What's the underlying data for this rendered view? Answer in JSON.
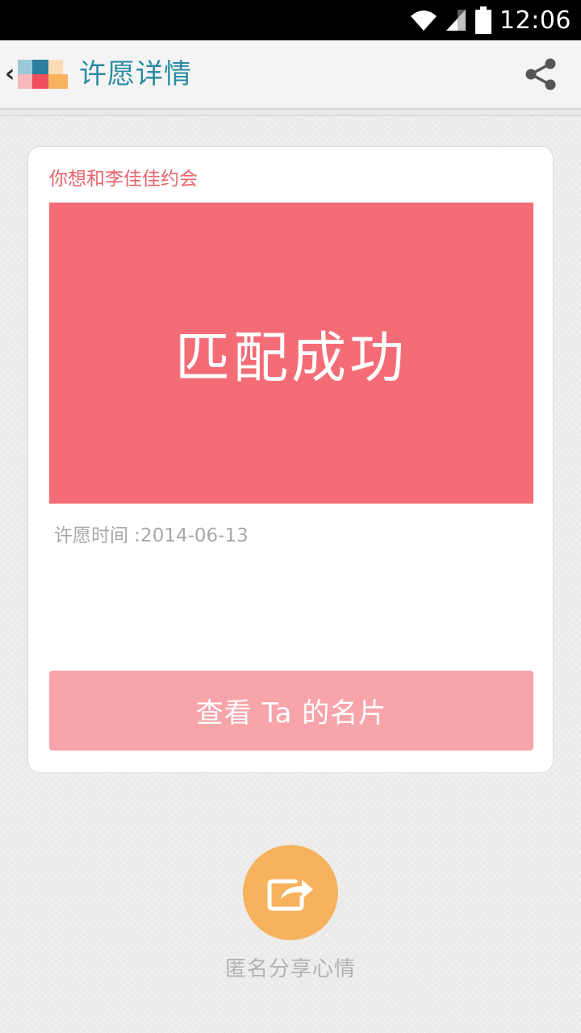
{
  "status_bar": {
    "time": "12:06",
    "icons": [
      "wifi-icon",
      "signal-icon",
      "battery-icon"
    ]
  },
  "header": {
    "back_icon": "chevron-left-icon",
    "logo": "app-logo-icon",
    "title": "许愿详情",
    "share_icon": "share-icon"
  },
  "card": {
    "wish_title": "你想和李佳佳约会",
    "match_status": "匹配成功",
    "wish_time": "许愿时间 :2014-06-13",
    "view_card_button": "查看 Ta 的名片"
  },
  "share_mood": {
    "icon": "share-out-icon",
    "label": "匿名分享心情"
  },
  "colors": {
    "accent_title": "#2a8aa3",
    "wish_title": "#e8636c",
    "banner": "#f46c76",
    "button": "#f7a4aa",
    "share_circle": "#f6b25c"
  }
}
